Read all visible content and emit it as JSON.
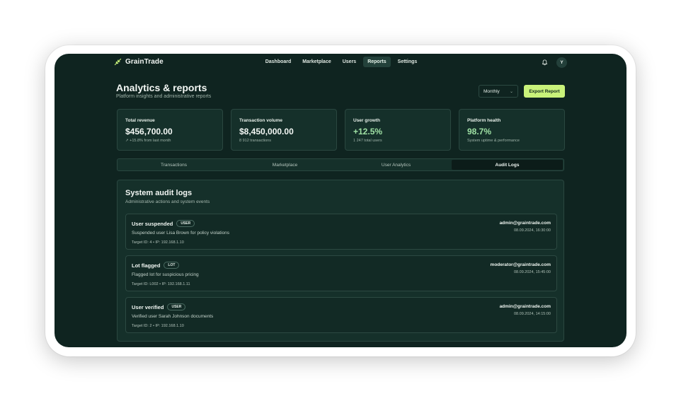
{
  "brand": {
    "name": "GrainTrade"
  },
  "nav": {
    "links": [
      {
        "label": "Dashboard"
      },
      {
        "label": "Marketplace"
      },
      {
        "label": "Users"
      },
      {
        "label": "Reports"
      },
      {
        "label": "Settings"
      }
    ],
    "active_link": "Reports",
    "avatar_initial": "Y"
  },
  "header": {
    "title": "Analytics & reports",
    "subtitle": "Platform insights and administrative reports",
    "period_select": "Monthly",
    "export_label": "Export Report"
  },
  "stats": [
    {
      "label": "Total revenue",
      "value": "$456,700.00",
      "note": "↗ +15.8% from last month"
    },
    {
      "label": "Transaction volume",
      "value": "$8,450,000.00",
      "note": "8 912 transactions"
    },
    {
      "label": "User growth",
      "value": "+12.5%",
      "note": "1 247 total users"
    },
    {
      "label": "Platform health",
      "value": "98.7%",
      "note": "System uptime & performance"
    }
  ],
  "tabs": [
    {
      "label": "Transactions"
    },
    {
      "label": "Marketplace"
    },
    {
      "label": "User Analytics"
    },
    {
      "label": "Audit Logs"
    }
  ],
  "active_tab": "Audit Logs",
  "audit": {
    "title": "System audit logs",
    "subtitle": "Administrative actions and system events",
    "entries": [
      {
        "title": "User suspended",
        "badge": "USER",
        "description": "Suspended user Lisa Brown for policy violations",
        "meta": "Target ID: 4 • IP: 192.168.1.10",
        "actor": "admin@graintrade.com",
        "time": "08.09.2024, 16:30:00"
      },
      {
        "title": "Lot flagged",
        "badge": "LOT",
        "description": "Flagged lot for suspicious pricing",
        "meta": "Target ID: L002 • IP: 192.168.1.11",
        "actor": "moderator@graintrade.com",
        "time": "08.09.2024, 15:45:00"
      },
      {
        "title": "User verified",
        "badge": "USER",
        "description": "Verified user Sarah Johnson documents",
        "meta": "Target ID: 2 • IP: 192.168.1.10",
        "actor": "admin@graintrade.com",
        "time": "08.09.2024, 14:15:00"
      }
    ]
  },
  "icons": {
    "logo": "wheat-icon",
    "notifications": "bell-icon",
    "select": "chevron-down-icon"
  },
  "colors": {
    "background": "#0f2420",
    "card": "#15302a",
    "accent": "#c9f27a",
    "positive": "#9fe0a4"
  }
}
